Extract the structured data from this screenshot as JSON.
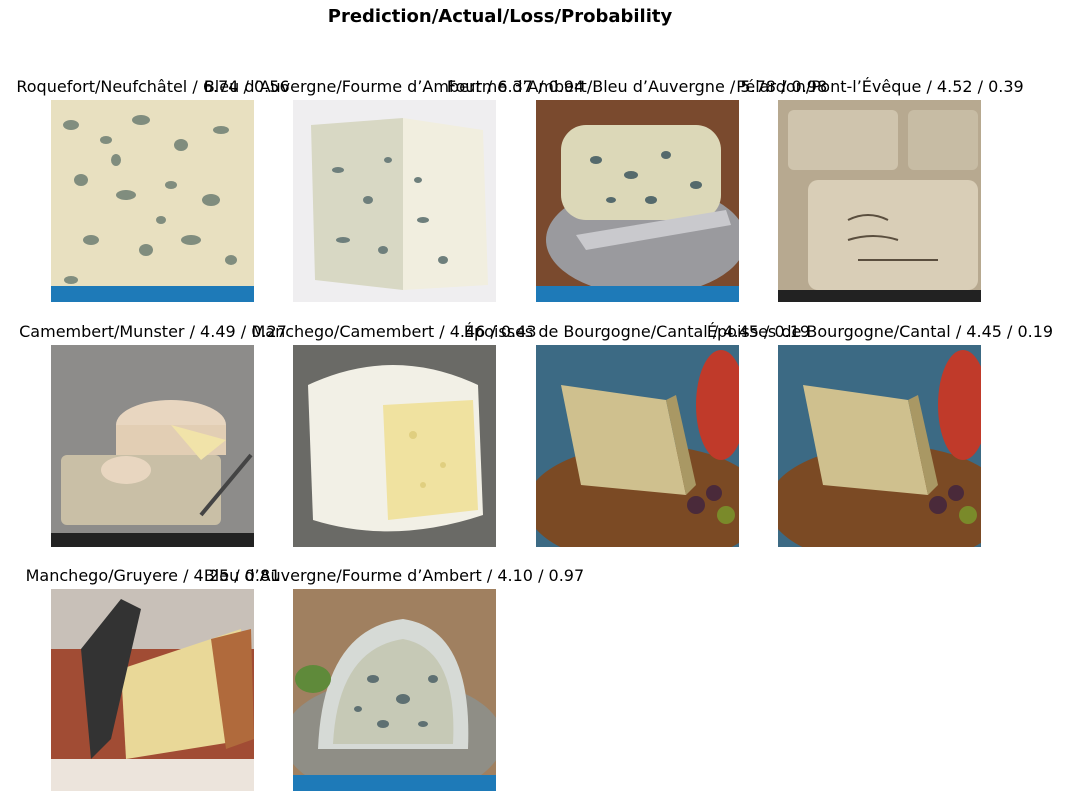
{
  "figure": {
    "title": "Prediction/Actual/Loss/Probability",
    "panels": [
      {
        "label": "Roquefort/Neufchâtel / 6.74 / 0.56",
        "depicts": "blue-veined cheese close-up",
        "colors": {
          "bg": "#e8e0c0",
          "vein": "#6f7f73",
          "accent": "#1e7ab8"
        }
      },
      {
        "label": "Bleu d’Auvergne/Fourme d’Ambert / 6.37 / 0.94",
        "depicts": "wedge of blue cheese",
        "colors": {
          "bg": "#efeef0",
          "vein": "#7a8a86",
          "accent": "#e5e2d2"
        }
      },
      {
        "label": "Fourme d’Ambert/Bleu d’Auvergne / 5.78 / 0.98",
        "depicts": "round blue cheese on plate with knife",
        "colors": {
          "bg": "#7a4a2e",
          "vein": "#566a6c",
          "accent": "#1e7ab8"
        }
      },
      {
        "label": "Pélardon/Pont-l’Évêque / 4.52 / 0.39",
        "depicts": "packaged Pont l'Évêque cheeses",
        "colors": {
          "bg": "#b7a990",
          "vein": "#8c7f6a",
          "accent": "#222222"
        }
      },
      {
        "label": "Camembert/Munster / 4.49 / 0.27",
        "depicts": "camembert wheel on board",
        "colors": {
          "bg": "#8d8c8a",
          "vein": "#e8d0b8",
          "accent": "#222222"
        }
      },
      {
        "label": "Manchego/Camembert / 4.46 / 0.43",
        "depicts": "white rind soft cheese cut",
        "colors": {
          "bg": "#6a6a66",
          "vein": "#f2f0e6",
          "accent": "#f0e2a0"
        }
      },
      {
        "label": "Époisses de Bourgogne/Cantal / 4.45 / 0.19",
        "depicts": "hard cheese with apple and olives",
        "colors": {
          "bg": "#3c6a84",
          "vein": "#cfc08e",
          "accent": "#c03a2a"
        }
      },
      {
        "label": "Époisses de Bourgogne/Cantal / 4.45 / 0.19",
        "depicts": "hard cheese with apple and olives",
        "colors": {
          "bg": "#3c6a84",
          "vein": "#cfc08e",
          "accent": "#c03a2a"
        }
      },
      {
        "label": "Manchego/Gruyere / 4.25 / 0.81",
        "depicts": "knife cutting manchego wedge",
        "colors": {
          "bg": "#a14c34",
          "vein": "#e9d898",
          "accent": "#333333"
        }
      },
      {
        "label": "Bleu d’Auvergne/Fourme d’Ambert / 4.10 / 0.97",
        "depicts": "half round blue cheese on plate",
        "colors": {
          "bg": "#a08060",
          "vein": "#7e8e90",
          "accent": "#1e7ab8"
        }
      }
    ]
  }
}
